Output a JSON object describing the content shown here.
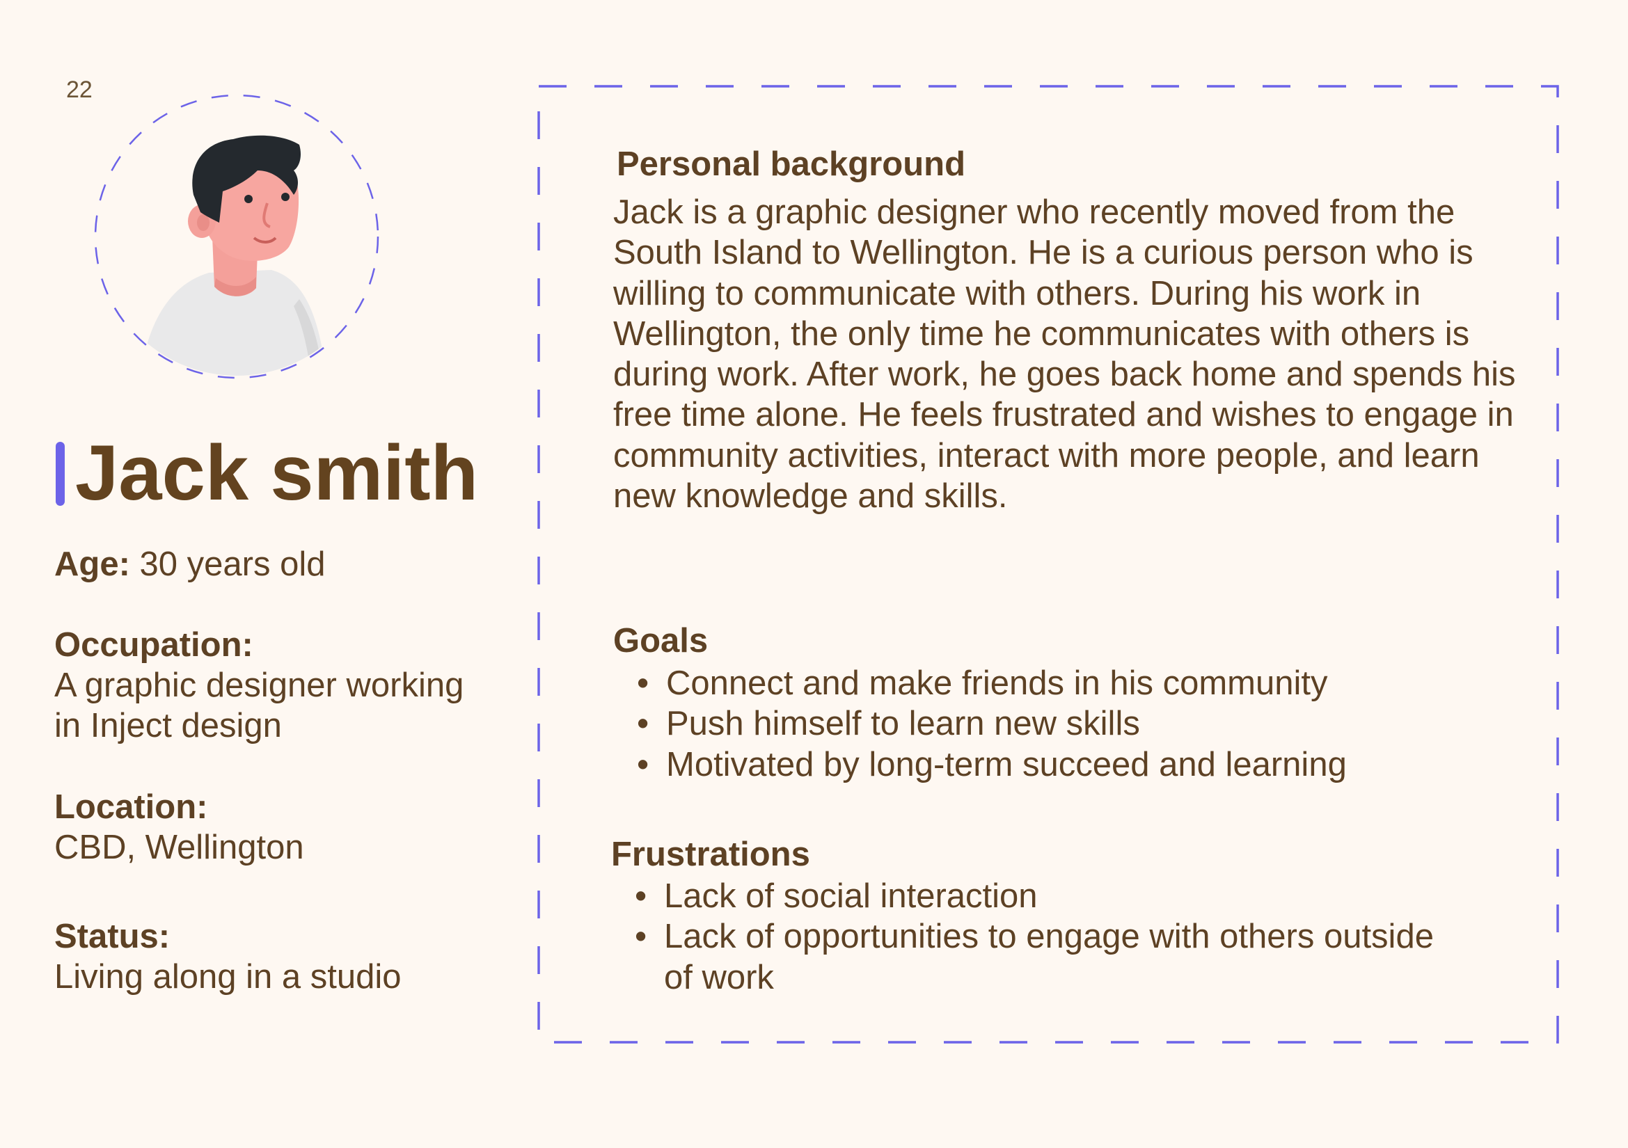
{
  "page_number": "22",
  "persona": {
    "name": "Jack smith",
    "age_label": "Age:",
    "age_value": "30 years old",
    "occupation_label": "Occupation:",
    "occupation_value": "A graphic designer working in Inject design",
    "location_label": "Location:",
    "location_value": "CBD, Wellington",
    "status_label": "Status:",
    "status_value": "Living along in a studio"
  },
  "background": {
    "title": "Personal background",
    "text": "Jack is a graphic designer who recently moved from the South Island to Wellington. He is a curious person who is willing to communicate with others. During his work in Wellington, the only time he communicates with others is during work. After work, he goes back home and spends his free time alone. He feels frustrated and wishes to engage in community activities, interact with more people, and learn new knowledge and skills."
  },
  "goals": {
    "title": "Goals",
    "items": [
      "Connect and make friends in his community",
      "Push himself to learn new skills",
      "Motivated by long-term succeed and learning"
    ]
  },
  "frustrations": {
    "title": "Frustrations",
    "items": [
      "Lack of social interaction",
      "Lack of opportunities to engage with others outside of work"
    ]
  },
  "colors": {
    "background": "#fef8f2",
    "text": "#5d4124",
    "accent": "#6c63e8"
  },
  "icons": {
    "avatar": "person-avatar-illustration"
  }
}
